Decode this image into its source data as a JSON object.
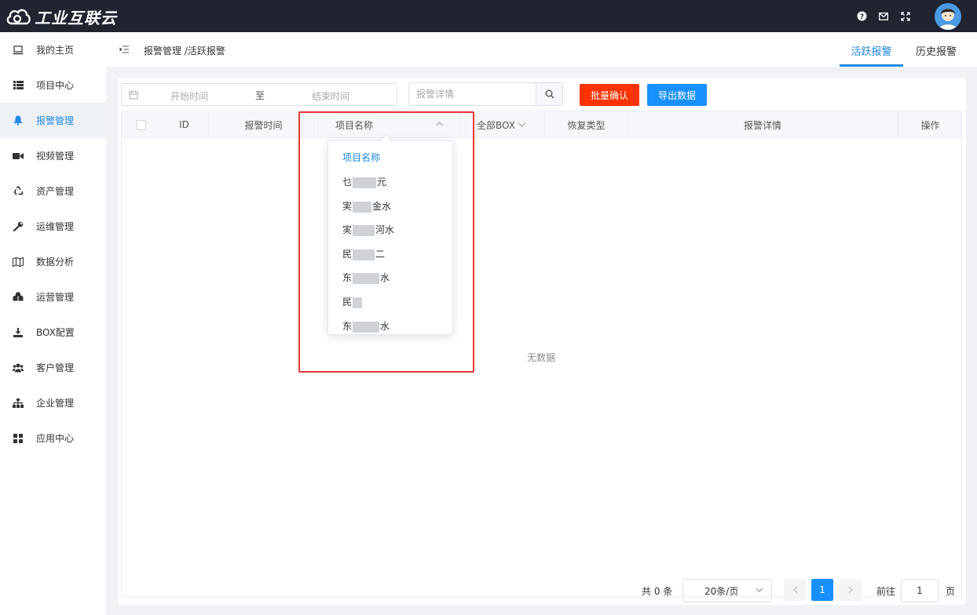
{
  "app": {
    "title": "工业互联云"
  },
  "header": {
    "icons": [
      "help-icon",
      "mail-icon",
      "fullscreen-icon"
    ]
  },
  "sidebar": {
    "items": [
      {
        "label": "我的主页",
        "icon": "laptop-icon"
      },
      {
        "label": "项目中心",
        "icon": "list-icon"
      },
      {
        "label": "报警管理",
        "icon": "bell-icon",
        "active": true
      },
      {
        "label": "视频管理",
        "icon": "video-camera-icon"
      },
      {
        "label": "资产管理",
        "icon": "recycle-icon"
      },
      {
        "label": "运维管理",
        "icon": "wrench-icon"
      },
      {
        "label": "数据分析",
        "icon": "map-icon"
      },
      {
        "label": "运营管理",
        "icon": "cubes-icon"
      },
      {
        "label": "BOX配置",
        "icon": "download-icon"
      },
      {
        "label": "客户管理",
        "icon": "users-icon"
      },
      {
        "label": "企业管理",
        "icon": "sitemap-icon"
      },
      {
        "label": "应用中心",
        "icon": "grid-icon"
      }
    ]
  },
  "breadcrumb": {
    "text": "报警管理 /活跃报警"
  },
  "tabs": [
    {
      "label": "活跃报警",
      "active": true
    },
    {
      "label": "历史报警",
      "active": false
    }
  ],
  "filters": {
    "start_placeholder": "开始时间",
    "separator": "至",
    "end_placeholder": "结束时间",
    "search_placeholder": "报警详情",
    "confirm_label": "批量确认",
    "export_label": "导出数据"
  },
  "table": {
    "columns": [
      "ID",
      "报警时间",
      "项目名称",
      "全部BOX",
      "恢复类型",
      "报警详情",
      "操作"
    ],
    "empty_text": "无数据"
  },
  "dropdown": {
    "items": [
      "项目名称",
      "乜",
      "実",
      "実",
      "民",
      "东",
      "民",
      "东"
    ],
    "tails": [
      "",
      "元",
      "金水",
      "河水",
      "二",
      "水",
      "",
      "水"
    ]
  },
  "pagination": {
    "total": "共 0 条",
    "page_size": "20条/页",
    "current_page": "1",
    "goto_label": "前往",
    "goto_value": "1",
    "page_unit": "页"
  },
  "colors": {
    "accent": "#1890ff",
    "danger": "#ff3300",
    "topbar": "#1f2430",
    "highlight": "#e53935"
  }
}
